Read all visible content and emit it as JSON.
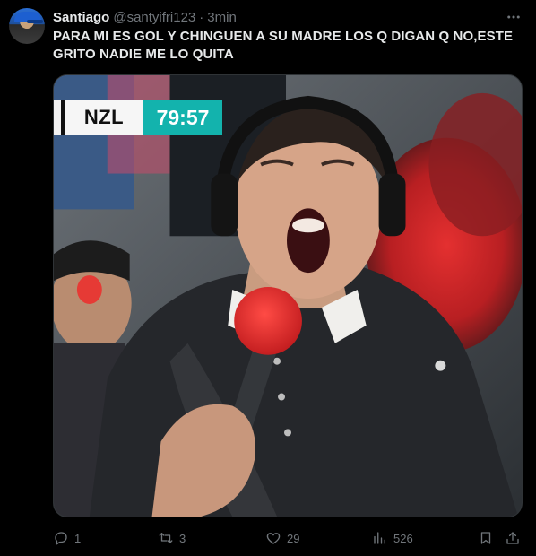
{
  "tweet": {
    "author_name": "Santiago",
    "author_handle": "@santyifri123",
    "separator": "·",
    "time": "3min",
    "text_line1": "PARA MI ES GOL Y CHINGUEN A SU MADRE LOS Q DIGAN Q NO,ESTE",
    "text_line2": "GRITO NADIE ME LO QUITA"
  },
  "media": {
    "scoreboard_team": "NZL",
    "scoreboard_clock": "79:57",
    "accent_color": "#13b3ad"
  },
  "actions": {
    "reply_count": "1",
    "retweet_count": "3",
    "like_count": "29",
    "views_count": "526"
  },
  "icons": {
    "more": "more-horizontal-icon",
    "reply": "reply-icon",
    "retweet": "retweet-icon",
    "like": "heart-icon",
    "views": "views-chart-icon",
    "bookmark": "bookmark-icon",
    "share": "share-icon"
  }
}
